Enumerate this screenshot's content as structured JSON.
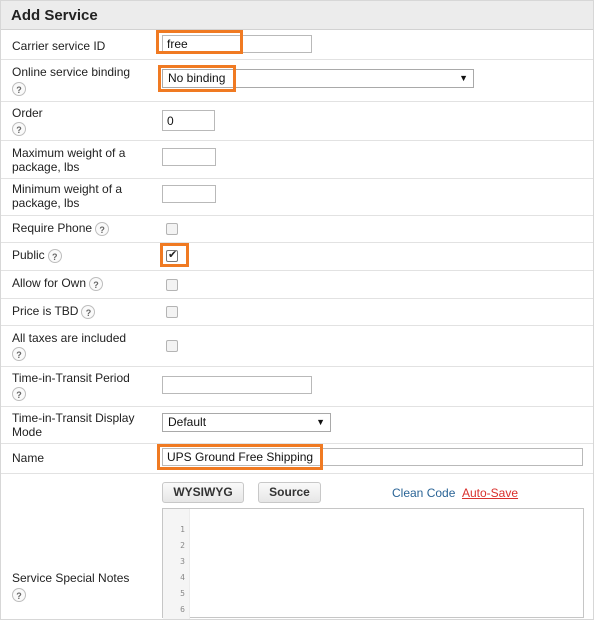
{
  "panel": {
    "title": "Add Service"
  },
  "help_glyph": "?",
  "fields": {
    "carrier_service_id": {
      "label": "Carrier service ID",
      "value": "free"
    },
    "online_binding": {
      "label": "Online service binding",
      "value": "No binding"
    },
    "order": {
      "label": "Order",
      "value": "0"
    },
    "max_weight": {
      "label_line1": "Maximum weight of a",
      "label_line2": "package, lbs",
      "value": ""
    },
    "min_weight": {
      "label_line1": "Minimum weight of a",
      "label_line2": "package, lbs",
      "value": ""
    },
    "require_phone": {
      "label": "Require Phone",
      "checked": false
    },
    "public": {
      "label": "Public",
      "checked": true
    },
    "allow_for_own": {
      "label": "Allow for Own",
      "checked": false
    },
    "price_tbd": {
      "label": "Price is TBD",
      "checked": false
    },
    "all_taxes": {
      "label": "All taxes are included",
      "checked": false
    },
    "transit_period": {
      "label": "Time-in-Transit Period",
      "value": ""
    },
    "transit_display": {
      "label_line1": "Time-in-Transit Display",
      "label_line2": "Mode",
      "value": "Default"
    },
    "name": {
      "label": "Name",
      "value": "UPS Ground Free Shipping"
    },
    "special_notes": {
      "label": "Service Special Notes"
    }
  },
  "editor": {
    "wysiwyg_label": "WYSIWYG",
    "source_label": "Source",
    "clean_code_label": "Clean Code",
    "auto_save_label": "Auto-Save",
    "line_numbers": [
      "1",
      "2",
      "3",
      "4",
      "5",
      "6"
    ]
  },
  "colors": {
    "highlight": "#f07a22",
    "link": "#2a6496",
    "auto_save_link": "#d9302c"
  }
}
